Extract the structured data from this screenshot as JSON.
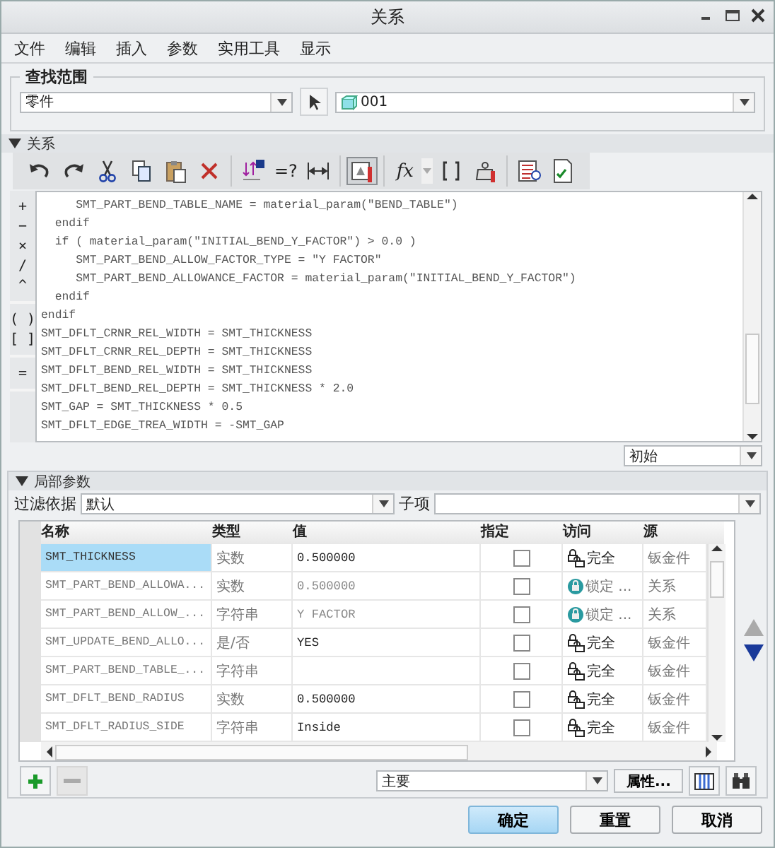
{
  "window": {
    "title": "关系"
  },
  "menu": [
    "文件",
    "编辑",
    "插入",
    "参数",
    "实用工具",
    "显示"
  ],
  "search_scope": {
    "title": "查找范围",
    "type_dropdown": "零件",
    "model_dropdown": "001"
  },
  "relations": {
    "title": "关系",
    "expanded": true,
    "toolbar": [
      [
        {
          "kind": "undo",
          "pressed": false
        },
        {
          "kind": "redo",
          "pressed": false
        },
        {
          "kind": "cut",
          "pressed": false
        },
        {
          "kind": "copy",
          "pressed": false
        },
        {
          "kind": "paste",
          "pressed": false
        },
        {
          "kind": "delete",
          "pressed": false
        }
      ],
      [
        {
          "kind": "switch",
          "pressed": false
        },
        {
          "kind": "verify",
          "label": "=?",
          "pressed": false
        },
        {
          "kind": "dimension",
          "pressed": false
        }
      ],
      [
        {
          "kind": "units",
          "pressed": true
        }
      ],
      [
        {
          "kind": "function",
          "label": "fx",
          "pressed": false
        },
        {
          "kind": "brackets",
          "pressed": false
        },
        {
          "kind": "mass",
          "pressed": false
        }
      ],
      [
        {
          "kind": "sort",
          "pressed": false
        },
        {
          "kind": "review",
          "pressed": false
        }
      ]
    ],
    "operators": [
      [
        "+",
        "−",
        "×",
        "/",
        "^"
      ],
      [
        "( )",
        "[ ]"
      ],
      [
        "="
      ]
    ],
    "code_lines": [
      "     SMT_PART_BEND_TABLE_NAME = material_param(\"BEND_TABLE\")",
      "  endif",
      "  if ( material_param(\"INITIAL_BEND_Y_FACTOR\") > 0.0 )",
      "     SMT_PART_BEND_ALLOW_FACTOR_TYPE = \"Y FACTOR\"",
      "     SMT_PART_BEND_ALLOWANCE_FACTOR = material_param(\"INITIAL_BEND_Y_FACTOR\")",
      "  endif",
      "endif",
      "SMT_DFLT_CRNR_REL_WIDTH = SMT_THICKNESS",
      "SMT_DFLT_CRNR_REL_DEPTH = SMT_THICKNESS",
      "SMT_DFLT_BEND_REL_WIDTH = SMT_THICKNESS",
      "SMT_DFLT_BEND_REL_DEPTH = SMT_THICKNESS * 2.0",
      "SMT_GAP = SMT_THICKNESS * 0.5",
      "SMT_DFLT_EDGE_TREA_WIDTH = -SMT_GAP"
    ],
    "mode_dropdown": "初始"
  },
  "local_params": {
    "title": "局部参数",
    "expanded": true,
    "filter_label": "过滤依据",
    "filter_value": "默认",
    "child_label": "子项",
    "columns": [
      "名称",
      "类型",
      "值",
      "指定",
      "访问",
      "源"
    ],
    "rows": [
      {
        "name": "SMT_THICKNESS",
        "type": "实数",
        "value": "0.500000",
        "designated": false,
        "locked": false,
        "access": "完全",
        "source": "钣金件",
        "selected": true
      },
      {
        "name": "SMT_PART_BEND_ALLOWA...",
        "type": "实数",
        "value": "0.500000",
        "designated": false,
        "locked": true,
        "access": "锁定 ...",
        "source": "关系",
        "selected": false
      },
      {
        "name": "SMT_PART_BEND_ALLOW_...",
        "type": "字符串",
        "value": "Y FACTOR",
        "designated": false,
        "locked": true,
        "access": "锁定 ...",
        "source": "关系",
        "selected": false
      },
      {
        "name": "SMT_UPDATE_BEND_ALLO...",
        "type": "是/否",
        "value": "YES",
        "designated": false,
        "locked": false,
        "access": "完全",
        "source": "钣金件",
        "selected": false
      },
      {
        "name": "SMT_PART_BEND_TABLE_...",
        "type": "字符串",
        "designated": false,
        "locked": false,
        "access": "完全",
        "source": "钣金件",
        "selected": false
      },
      {
        "name": "SMT_DFLT_BEND_RADIUS",
        "type": "实数",
        "value": "0.500000",
        "designated": false,
        "locked": false,
        "access": "完全",
        "source": "钣金件",
        "selected": false
      },
      {
        "name": "SMT_DFLT_RADIUS_SIDE",
        "type": "字符串",
        "value": "Inside",
        "designated": false,
        "locked": false,
        "access": "完全",
        "source": "钣金件",
        "selected": false
      }
    ],
    "row_buttons": [
      {
        "kind": "add",
        "disabled": false
      },
      {
        "kind": "remove",
        "disabled": true
      }
    ],
    "view_dropdown": "主要",
    "properties_button": "属性..."
  },
  "buttons": [
    {
      "label": "确定",
      "kind": "primary"
    },
    {
      "label": "重置",
      "kind": "normal"
    },
    {
      "label": "取消",
      "kind": "normal"
    }
  ]
}
